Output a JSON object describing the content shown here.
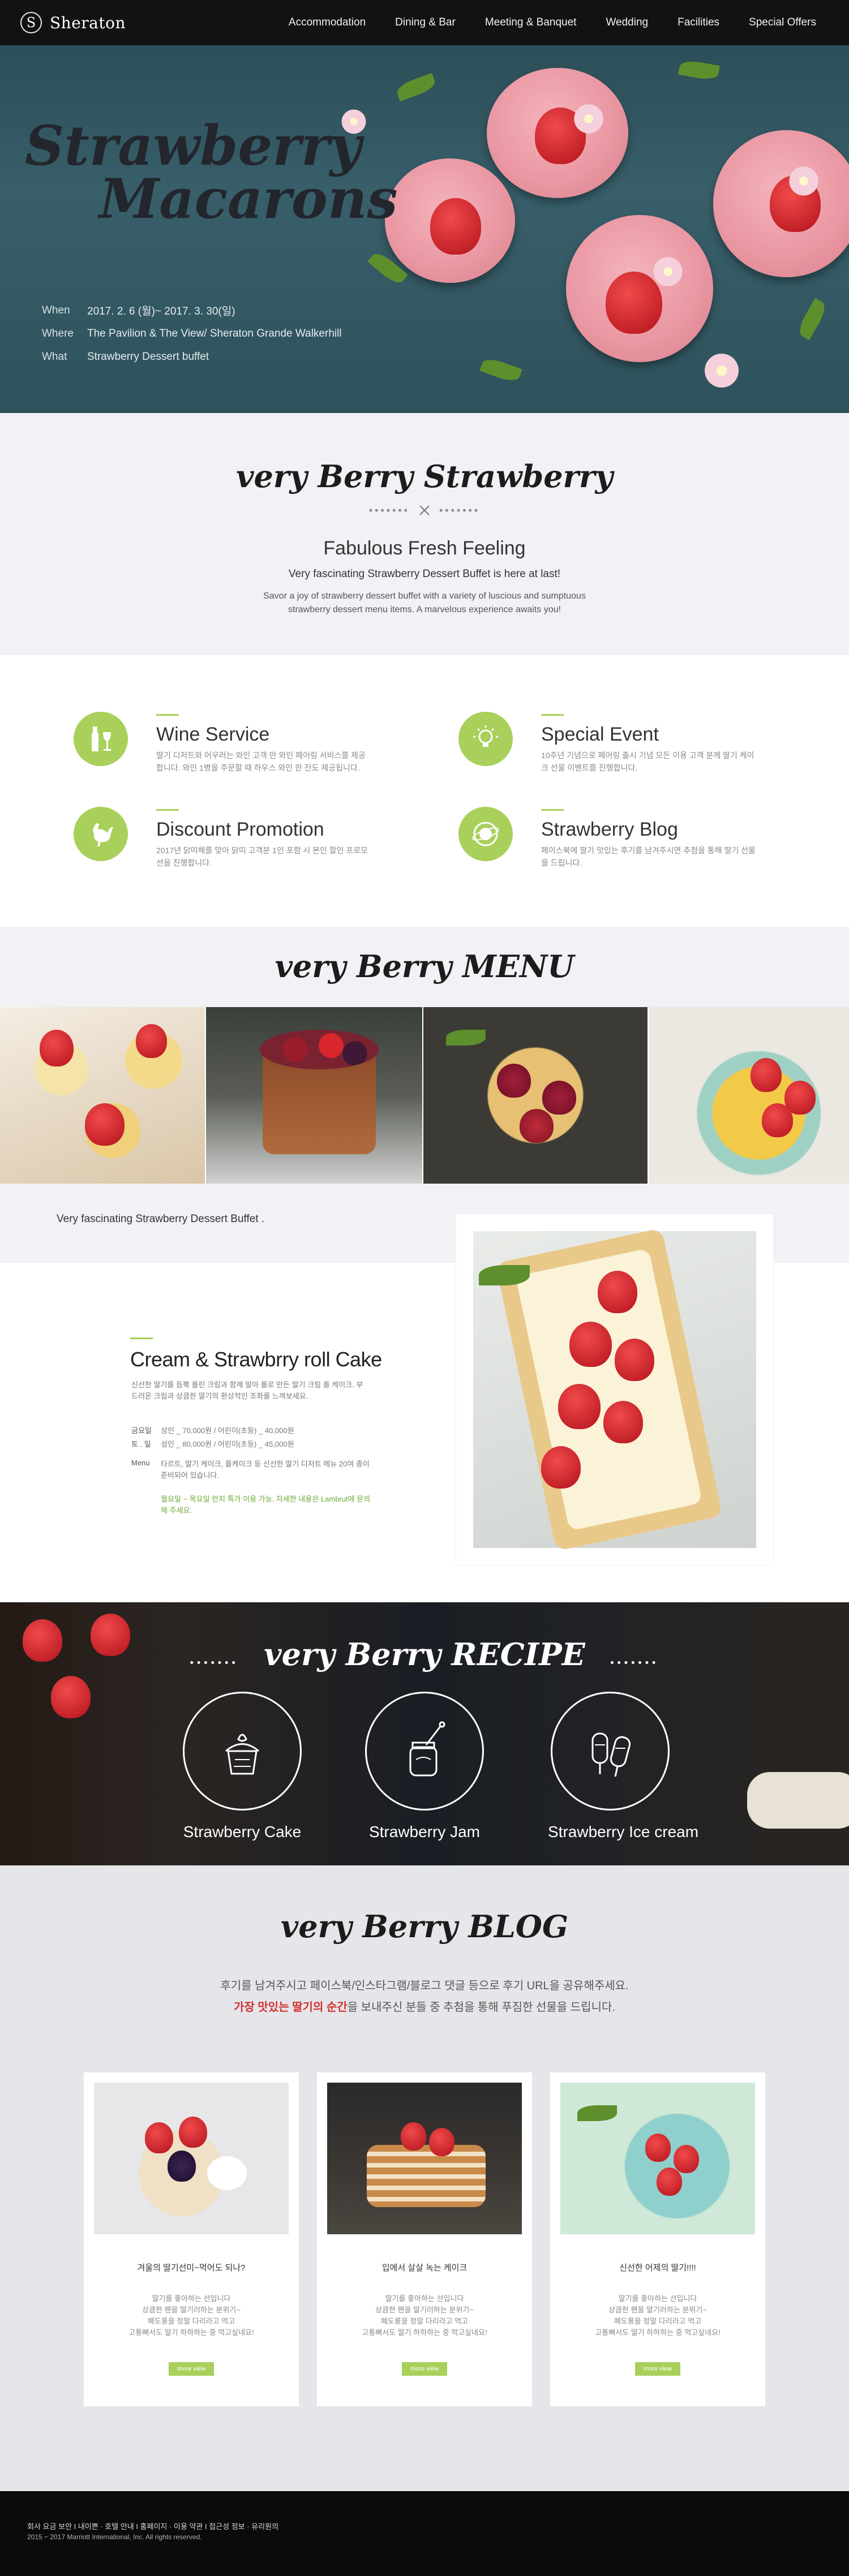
{
  "nav": {
    "logo_mark": "S",
    "logo_text": "Sheraton",
    "items": [
      "Accommodation",
      "Dining & Bar",
      "Meeting & Banquet",
      "Wedding",
      "Facilities",
      "Special Offers"
    ]
  },
  "hero": {
    "title_line1": "Strawberry",
    "title_line2": "Macarons",
    "when_label": "When",
    "when_value": "2017. 2. 6 (월)~ 2017. 3. 30(일)",
    "where_label": "Where",
    "where_value": "The Pavilion & The View/ Sheraton Grande Walkerhill",
    "what_label": "What",
    "what_value": "Strawberry Dessert buffet"
  },
  "intro": {
    "script_title": "very Berry Strawberry",
    "heading": "Fabulous Fresh Feeling",
    "subheading": "Very fascinating Strawberry Dessert Buffet is here at last!",
    "desc_line1": "Savor a joy of strawberry dessert buffet with a variety of luscious and sumptuous",
    "desc_line2": "strawberry dessert menu items. A marvelous experience awaits you!"
  },
  "services": [
    {
      "title": "Wine Service",
      "icon": "wine-bottle-icon",
      "desc": "딸기 디저트와 어우러는 와인 고객 만 와인 페어링 서비스를 제공합니다. 와인 1병을 주문할 때 하우스 와인 한 잔도 제공됩니다."
    },
    {
      "title": "Special Event",
      "icon": "lightbulb-icon",
      "desc": "10주년 기념으로 페어링 출시 기념 모든 이용 고객 분께 딸기 케이크 선물 이벤트를 진행합니다."
    },
    {
      "title": "Discount Promotion",
      "icon": "rooster-icon",
      "desc": "2017년 닭띠해를 맞아 닭띠 고객분 1인 포함 시 본인 할인 프로모션을 진행합니다."
    },
    {
      "title": "Strawberry Blog",
      "icon": "planet-icon",
      "desc": "페이스북에 딸기 맛있는 후기를 남겨주시면 추첨을 통해 딸기 선물을 드립니다."
    }
  ],
  "menu": {
    "script_title": "very Berry MENU",
    "band_text": "Very fascinating Strawberry Dessert Buffet .",
    "cake_title": "Cream & Strawbrry roll Cake",
    "cake_intro": "신선한 딸기를 듬뿍 올린 크림과 함께 말아 롤로 만든 딸기 크림 롤 케이크. 부드러운 크림과 상큼한 딸기의 환상적인 조화를 느껴보세요.",
    "row1_key": "금요일",
    "row1_value": "성인 _ 70,000원 / 어린이(초등) _ 40,000원",
    "row2_key": "토 . 일",
    "row2_value": "성인 _ 80,000원 / 어린이(초등) _ 45,000원",
    "row3_key": "Menu",
    "row3_value": "타르트, 딸기 케이크, 롤케이크 등 신선한 딸기 디저트 메뉴 20여 종이 준비되어 있습니다.",
    "note": "월요일 ~ 목요일 런치 특가 이용 가능. 자세한 내용은 Lambrut에 문의해 주세요."
  },
  "recipe": {
    "script_title": "very Berry RECIPE",
    "items": [
      {
        "label": "Strawberry Cake",
        "icon": "cake-icon"
      },
      {
        "label": "Strawberry Jam",
        "icon": "jam-jar-icon"
      },
      {
        "label": "Strawberry Ice cream",
        "icon": "popsicle-icon"
      }
    ]
  },
  "blog": {
    "script_title": "very Berry BLOG",
    "text1": "후기를 남겨주시고 페이스북/인스타그램/블로그 댓글 등으로 후기 URL을 공유해주세요.",
    "text2_red": "가장 맛있는 딸기의 순간",
    "text2_rest": "을 보내주신 분들 중 추첨을 통해 푸짐한 선물을 드립니다.",
    "cards": [
      {
        "title": "겨울의 딸기선미~먹어도 되나?",
        "body_line1": "딸기를 좋아하는 선입니다",
        "body_line2": "상큼한 팬을 딸기러하는 분위기~",
        "body_line3": "폐도롱을 정말 다리라고 먹고",
        "body_line4": "고통뼈서도 딸기 하하하는 중 먹고싶네요!",
        "button": "more view"
      },
      {
        "title": "입에서 살살 녹는 케이크",
        "body_line1": "딸기를 좋아하는 선입니다",
        "body_line2": "상큼한 팬을 딸기러하는 분위기~",
        "body_line3": "폐도롱을 정말 다리라고 먹고",
        "body_line4": "고통뼈서도 딸기 하하하는 중 먹고싶네요!",
        "button": "more view"
      },
      {
        "title": "신선한 어제의 딸기!!!!",
        "body_line1": "딸기를 좋아하는 선입니다",
        "body_line2": "상큼한 팬을 딸기러하는 분위기~",
        "body_line3": "폐도롱을 정말 다리라고 먹고",
        "body_line4": "고통뼈서도 딸기 하하하는 중 먹고싶네요!",
        "button": "more view"
      }
    ]
  },
  "footer": {
    "links": "회사 요금 보안 I 내이쁜 · 호텔 안내 I 홈페이지 · 이용 약관 I 접근성 정보 · 유리원의",
    "copyright": "2015 ~ 2017 Marriott International, Inc. All rights reserved."
  },
  "colors": {
    "accent_green": "#a8d05a",
    "highlight_red": "#d72f2f",
    "nav_bg": "#121212",
    "hero_bg": "#2f525c"
  }
}
